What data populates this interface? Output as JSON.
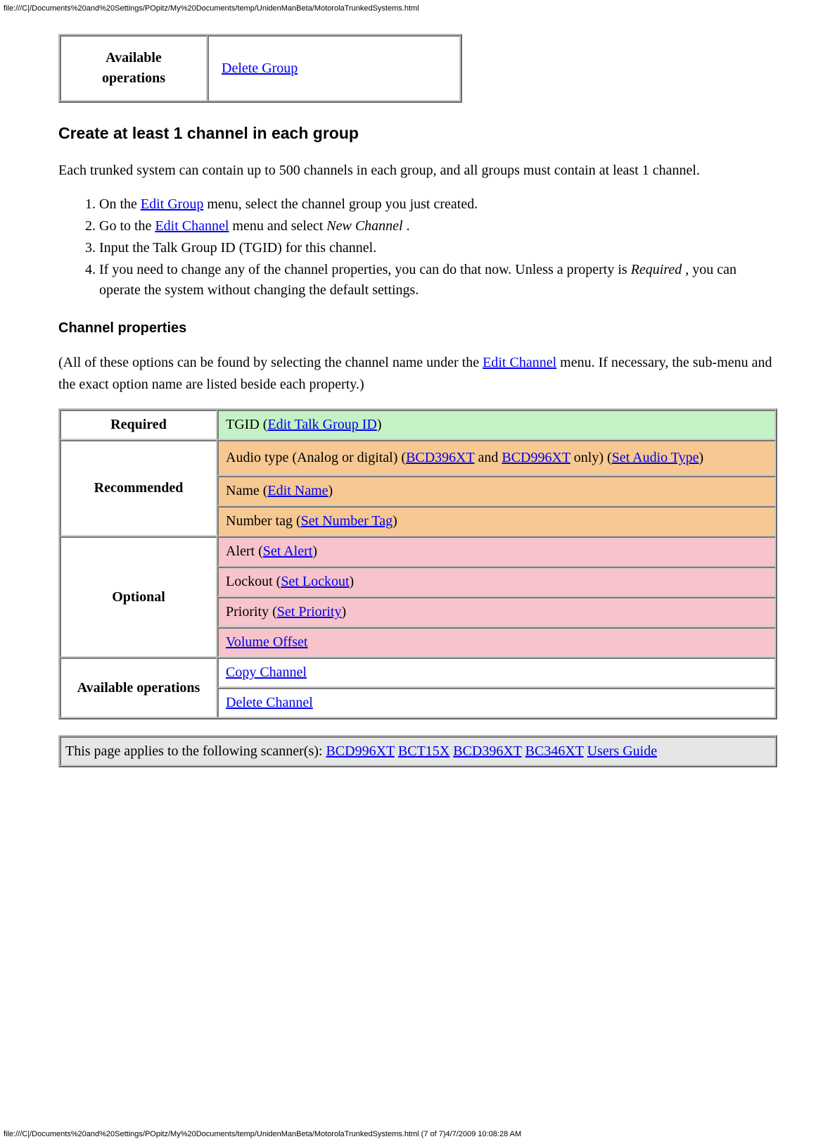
{
  "meta": {
    "url_top": "file:///C|/Documents%20and%20Settings/POpitz/My%20Documents/temp/UnidenManBeta/MotorolaTrunkedSystems.html",
    "url_bottom": "file:///C|/Documents%20and%20Settings/POpitz/My%20Documents/temp/UnidenManBeta/MotorolaTrunkedSystems.html (7 of 7)4/7/2009 10:08:28 AM"
  },
  "ops_table": {
    "header": "Available operations",
    "link": "Delete Group"
  },
  "section1": {
    "heading": "Create at least 1 channel in each group",
    "intro": "Each trunked system can contain up to 500 channels in each group, and all groups must contain at least 1 channel.",
    "steps": {
      "s1_a": "On the ",
      "s1_link": "Edit Group",
      "s1_b": " menu, select the channel group you just created.",
      "s2_a": "Go to the ",
      "s2_link": "Edit Channel",
      "s2_b": " menu and select ",
      "s2_em": "New Channel",
      "s2_c": " .",
      "s3": "Input the Talk Group ID (TGID) for this channel.",
      "s4_a": "If you need to change any of the channel properties, you can do that now. Unless a property is ",
      "s4_em": "Required",
      "s4_b": " , you can operate the system without changing the default settings."
    }
  },
  "section2": {
    "heading": "Channel properties",
    "intro_a": "(All of these options can be found by selecting the channel name under the ",
    "intro_link": "Edit Channel",
    "intro_b": " menu. If necessary, the sub-menu and the exact option name are listed beside each property.)"
  },
  "prop_table": {
    "required": {
      "label": "Required",
      "row1_a": "TGID (",
      "row1_link": "Edit Talk Group ID",
      "row1_b": ")"
    },
    "recommended": {
      "label": "Recommended",
      "row1_a": "Audio type (Analog or digital) (",
      "row1_link1": "BCD396XT",
      "row1_mid": " and ",
      "row1_link2": "BCD996XT",
      "row1_b": " only) (",
      "row1_link3": "Set Audio Type",
      "row1_c": ")",
      "row2_a": "Name (",
      "row2_link": "Edit Name",
      "row2_b": ")",
      "row3_a": "Number tag (",
      "row3_link": "Set Number Tag",
      "row3_b": ")"
    },
    "optional": {
      "label": "Optional",
      "row1_a": "Alert (",
      "row1_link": "Set Alert",
      "row1_b": ")",
      "row2_a": "Lockout (",
      "row2_link": "Set Lockout",
      "row2_b": ")",
      "row3_a": "Priority (",
      "row3_link": "Set Priority",
      "row3_b": ")",
      "row4_link": "Volume Offset"
    },
    "available": {
      "label": "Available operations",
      "row1_link": "Copy Channel",
      "row2_link": "Delete Channel"
    }
  },
  "footer": {
    "text_a": "This page applies to the following scanner(s): ",
    "link1": "BCD996XT",
    "sp": " ",
    "link2": "BCT15X",
    "link3": "BCD396XT",
    "link4": "BC346XT",
    "link5": "Users Guide"
  }
}
